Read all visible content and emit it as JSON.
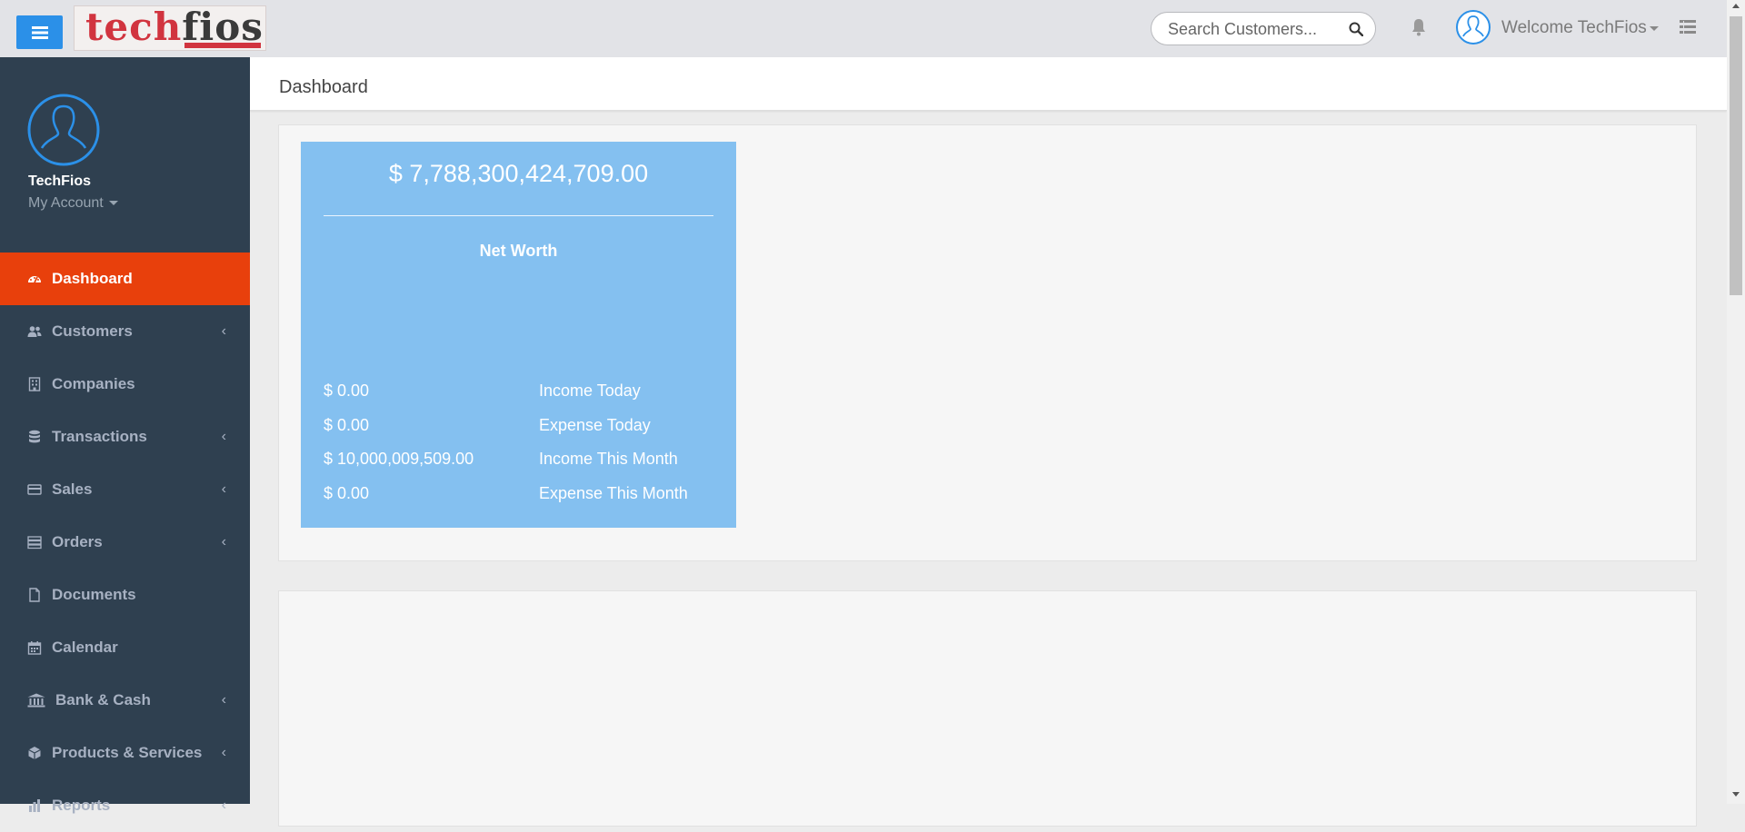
{
  "header": {
    "logo_text": "techfios",
    "search_placeholder": "Search Customers...",
    "welcome": "Welcome TechFios"
  },
  "sidebar": {
    "user_name": "TechFios",
    "account_label": "My Account",
    "items": [
      {
        "label": "Dashboard",
        "icon": "dashboard-icon",
        "active": true
      },
      {
        "label": "Customers",
        "icon": "users-icon",
        "has_submenu": true
      },
      {
        "label": "Companies",
        "icon": "building-icon"
      },
      {
        "label": "Transactions",
        "icon": "database-icon",
        "has_submenu": true
      },
      {
        "label": "Sales",
        "icon": "credit-card-icon",
        "has_submenu": true
      },
      {
        "label": "Orders",
        "icon": "server-icon",
        "has_submenu": true
      },
      {
        "label": "Documents",
        "icon": "file-icon"
      },
      {
        "label": "Calendar",
        "icon": "calendar-icon"
      },
      {
        "label": "Bank & Cash",
        "icon": "bank-icon",
        "has_submenu": true
      },
      {
        "label": "Products & Services",
        "icon": "cube-icon",
        "has_submenu": true
      },
      {
        "label": "Reports",
        "icon": "bar-chart-icon",
        "has_submenu": true
      }
    ]
  },
  "page": {
    "title": "Dashboard"
  },
  "net_worth": {
    "value": "$ 7,788,300,424,709.00",
    "label": "Net Worth",
    "stats": [
      {
        "value": "$ 0.00",
        "label": "Income Today"
      },
      {
        "value": "$ 0.00",
        "label": "Expense Today"
      },
      {
        "value": "$ 10,000,009,509.00",
        "label": "Income This Month"
      },
      {
        "value": "$ 0.00",
        "label": "Expense This Month"
      }
    ]
  },
  "colors": {
    "accent": "#e8400c",
    "sidebar_bg": "#2f4050",
    "card_bg": "#84c0f0",
    "toggle_btn": "#2b90e8"
  }
}
